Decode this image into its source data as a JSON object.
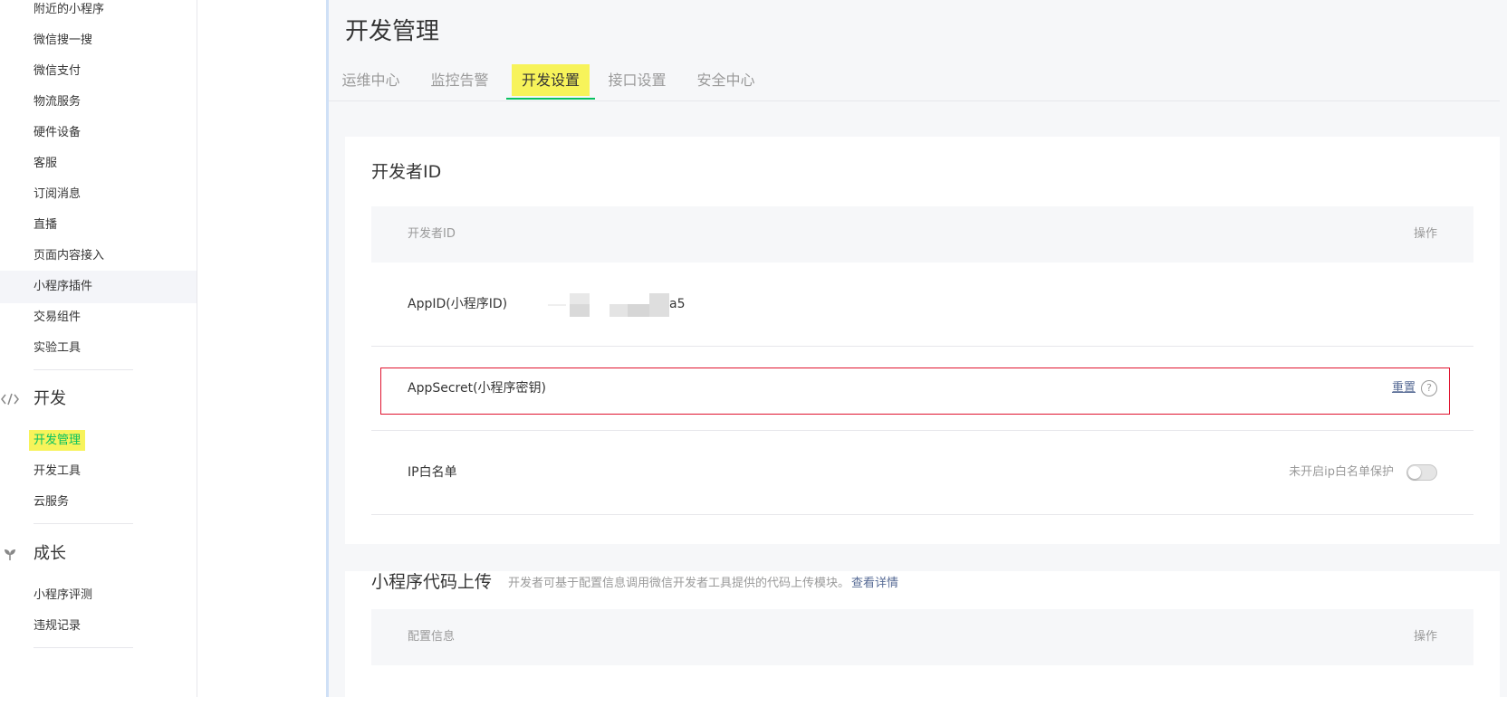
{
  "sidebar": {
    "items": [
      {
        "label": "附近的小程序"
      },
      {
        "label": "微信搜一搜"
      },
      {
        "label": "微信支付"
      },
      {
        "label": "物流服务"
      },
      {
        "label": "硬件设备"
      },
      {
        "label": "客服"
      },
      {
        "label": "订阅消息"
      },
      {
        "label": "直播"
      },
      {
        "label": "页面内容接入"
      },
      {
        "label": "小程序插件"
      },
      {
        "label": "交易组件"
      },
      {
        "label": "实验工具"
      }
    ],
    "dev_section": {
      "icon": "code-icon",
      "label": "开发",
      "items": [
        {
          "label": "开发管理",
          "active": true
        },
        {
          "label": "开发工具"
        },
        {
          "label": "云服务"
        }
      ]
    },
    "growth_section": {
      "icon": "sprout-icon",
      "label": "成长",
      "items": [
        {
          "label": "小程序评测"
        },
        {
          "label": "违规记录"
        }
      ]
    }
  },
  "main": {
    "title": "开发管理",
    "tabs": [
      {
        "label": "运维中心"
      },
      {
        "label": "监控告警"
      },
      {
        "label": "开发设置",
        "active": true
      },
      {
        "label": "接口设置"
      },
      {
        "label": "安全中心"
      }
    ],
    "developer_id": {
      "title": "开发者ID",
      "header": {
        "col1": "开发者ID",
        "col2": "操作"
      },
      "appid_label": "AppID(小程序ID)",
      "appid_value_visible": "a5",
      "appsecret_label": "AppSecret(小程序密钥)",
      "reset_label": "重置",
      "help_glyph": "?",
      "ip_label": "IP白名单",
      "ip_status": "未开启ip白名单保护",
      "ip_protection_enabled": false
    },
    "code_upload": {
      "title": "小程序代码上传",
      "desc": "开发者可基于配置信息调用微信开发者工具提供的代码上传模块。",
      "link": "查看详情",
      "header": {
        "col1": "配置信息",
        "col2": "操作"
      }
    }
  },
  "colors": {
    "accent_green": "#07c160",
    "highlight_yellow": "#f7f35a",
    "link_blue": "#576b95",
    "alert_red": "#e0142f"
  }
}
